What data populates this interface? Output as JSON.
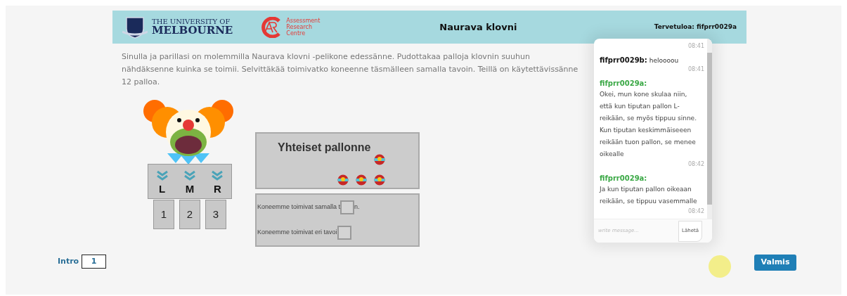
{
  "header": {
    "university_line1": "THE UNIVERSITY OF",
    "university_line2": "MELBOURNE",
    "centre_lines": [
      "Assessment",
      "Research",
      "Centre"
    ],
    "title": "Naurava klovni",
    "welcome": "Tervetuloa: fifprr0029a"
  },
  "instructions": "Sinulla ja parillasi on molemmilla Naurava klovni -pelikone edessänne. Pudottakaa palloja klovnin suuhun nähdäksenne kuinka se toimii. Selvittäkää toimivatko koneenne täsmälleen samalla tavoin. Teillä on käytettävissänne 12 palloa.",
  "machine": {
    "holes": [
      "L",
      "M",
      "R"
    ],
    "slots": [
      "1",
      "2",
      "3"
    ]
  },
  "balls_panel": {
    "title": "Yhteiset pallonne"
  },
  "answers": [
    {
      "before": "Koneemme toimivat samalla t",
      "after": "n.",
      "checked": false
    },
    {
      "before": "Koneemme toimivat eri tavoi",
      "checked": false
    }
  ],
  "chat": {
    "messages": [
      {
        "kind": "block",
        "time": "08:41"
      },
      {
        "kind": "inline",
        "sender": "fifprr0029b:",
        "text": "heloooou",
        "time": "08:41"
      },
      {
        "kind": "block",
        "sender": "fifprr0029a:",
        "text": "Okei, mun kone skulaa niin, että kun tiputan pallon L-reikään, se myös tippuu sinne. Kun tiputan keskimmäiseeen reikään tuon pallon, se menee oikealle",
        "time": "08:42"
      },
      {
        "kind": "block",
        "sender": "fifprr0029a:",
        "text": "Ja kun tiputan pallon oikeaan reikään, se tippuu vasemmalle",
        "time": "08:42"
      }
    ],
    "input_placeholder": "write message...",
    "send": "Lähetä"
  },
  "footer": {
    "intro_label": "Intro",
    "intro_value": "1",
    "done": "Valmis"
  }
}
